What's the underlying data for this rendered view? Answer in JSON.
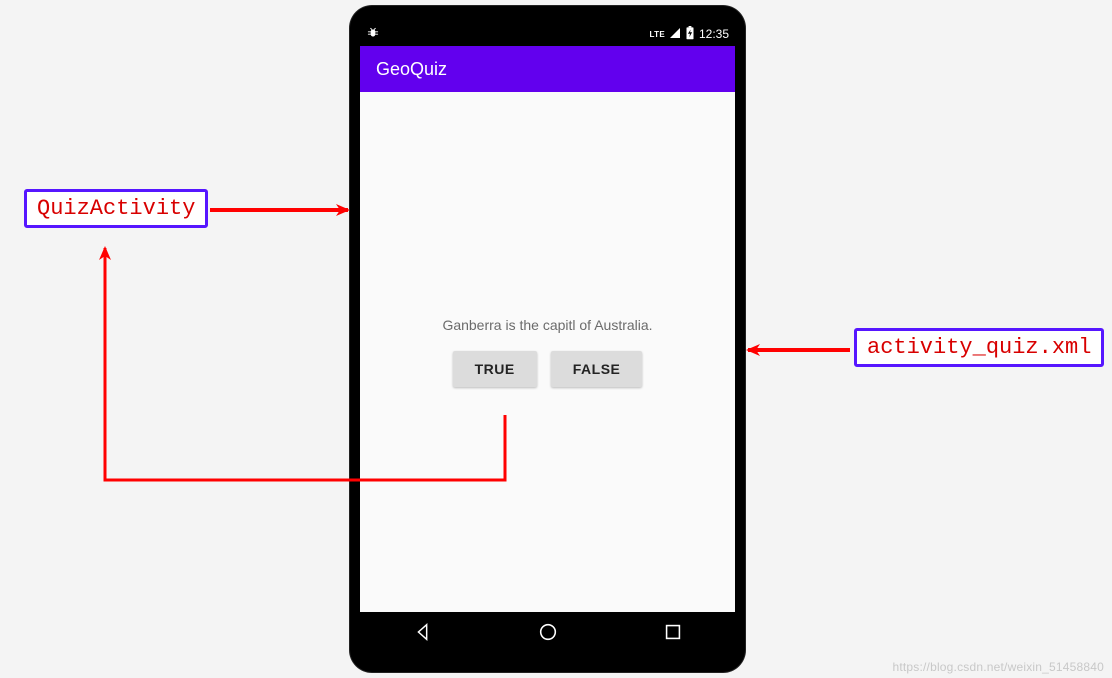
{
  "annotations": {
    "left_label": "QuizActivity",
    "right_label": "activity_quiz.xml"
  },
  "statusbar": {
    "lte": "LTE",
    "time": "12:35"
  },
  "app": {
    "title": "GeoQuiz",
    "question": "Ganberra is the capitl of Australia.",
    "true_label": "TRUE",
    "false_label": "FALSE"
  },
  "watermark": "https://blog.csdn.net/weixin_51458840",
  "colors": {
    "accent": "#6200ee",
    "annotation_border": "#5616ff",
    "annotation_text": "#d80000",
    "arrow": "#ff0000"
  }
}
